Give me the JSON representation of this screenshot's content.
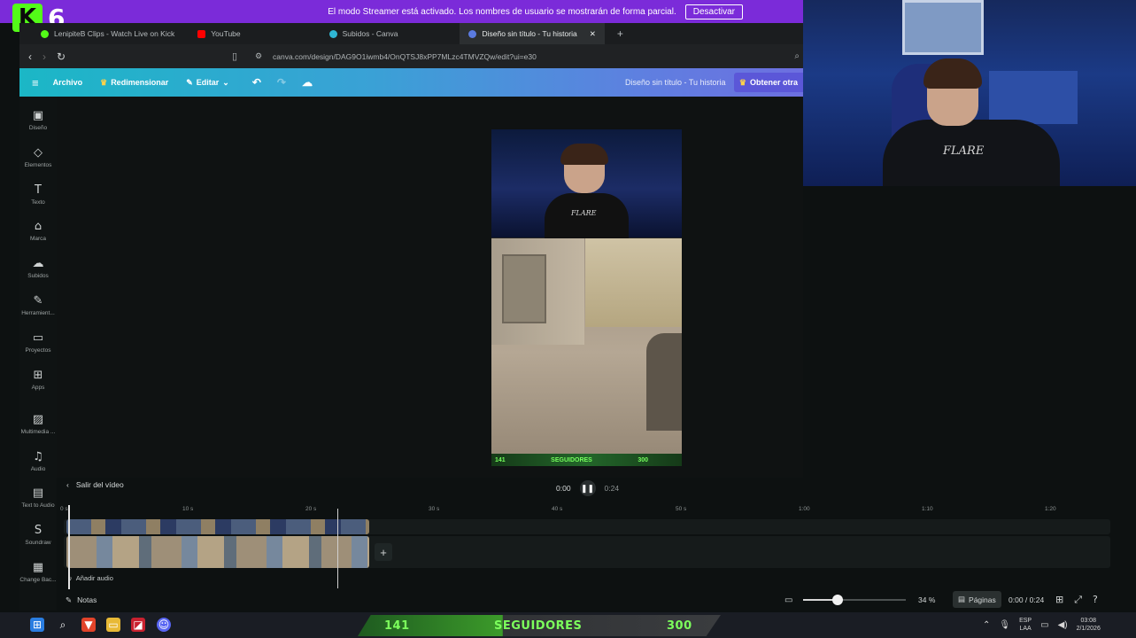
{
  "overlay": {
    "kick_logo": "K",
    "kick_viewers": "6"
  },
  "streamer_bar": {
    "message": "El modo Streamer está activado. Los nombres de usuario se mostrarán de forma parcial.",
    "button": "Desactivar"
  },
  "tabs": [
    {
      "label": "LenipiteB Clips - Watch Live on Kick",
      "color": "#53fc18"
    },
    {
      "label": "YouTube",
      "color": "#ff0000"
    },
    {
      "label": "Subidos - Canva",
      "color": "#2fb6d3"
    },
    {
      "label": "Diseño sin título - Tu historia",
      "color": "#5b7be0",
      "active": true
    }
  ],
  "new_tab_icon": "+",
  "address": {
    "url": "canva.com/design/DAG9O1iwmb4/OnQTSJ8xPP7MLzc4TMVZQw/edit?ui=e30"
  },
  "canva_toolbar": {
    "menu_icon": "≡",
    "archivo": "Archivo",
    "redimensionar": "Redimensionar",
    "editar": "Editar",
    "title": "Diseño sin título - Tu historia",
    "obtain": "Obtener otra"
  },
  "sidebar": [
    {
      "label": "Diseño",
      "icon": "▣"
    },
    {
      "label": "Elementos",
      "icon": "◇"
    },
    {
      "label": "Texto",
      "icon": "T"
    },
    {
      "label": "Marca",
      "icon": "⌂"
    },
    {
      "label": "Subidos",
      "icon": "☁"
    },
    {
      "label": "Herramient...",
      "icon": "✎"
    },
    {
      "label": "Proyectos",
      "icon": "▭"
    },
    {
      "label": "Apps",
      "icon": "⊞"
    },
    {
      "label": "Multimedia ...",
      "icon": "▨"
    },
    {
      "label": "Audio",
      "icon": "♫"
    },
    {
      "label": "Text to Audio",
      "icon": "▤"
    },
    {
      "label": "Soundraw",
      "icon": "S"
    },
    {
      "label": "Change Bac...",
      "icon": "▦"
    }
  ],
  "preview": {
    "shirt_text": "FLARE",
    "hud_left": "141",
    "hud_mid": "SEGUIDORES",
    "hud_right": "300"
  },
  "webcam": {
    "shirt_text": "FLARE"
  },
  "video_controls": {
    "exit": "Salir del vídeo",
    "current": "0:00",
    "duration": "0:24",
    "pause_icon": "❚❚"
  },
  "timeline": {
    "ticks": [
      "0 s",
      "10 s",
      "20 s",
      "30 s",
      "40 s",
      "50 s",
      "1:00",
      "1:10",
      "1:20"
    ],
    "add_clip": "+",
    "add_audio": "Añadir audio"
  },
  "bottom_bar": {
    "notes": "Notas",
    "zoom": "34 %",
    "zoom_fraction": 0.34,
    "pages": "Páginas",
    "page_count": "0:00 / 0:24"
  },
  "follow_goal": {
    "current": "141",
    "label": "SEGUIDORES",
    "goal": "300"
  },
  "tray": {
    "lang1": "ESP",
    "lang2": "LAA",
    "time": "03:08",
    "date": "2/1/2026"
  },
  "colors": {
    "streamer_bar": "#7b2bd9",
    "kick_green": "#53fc18",
    "canva_gradient_start": "#1bb7c6",
    "canva_gradient_end": "#6d6fe0"
  }
}
